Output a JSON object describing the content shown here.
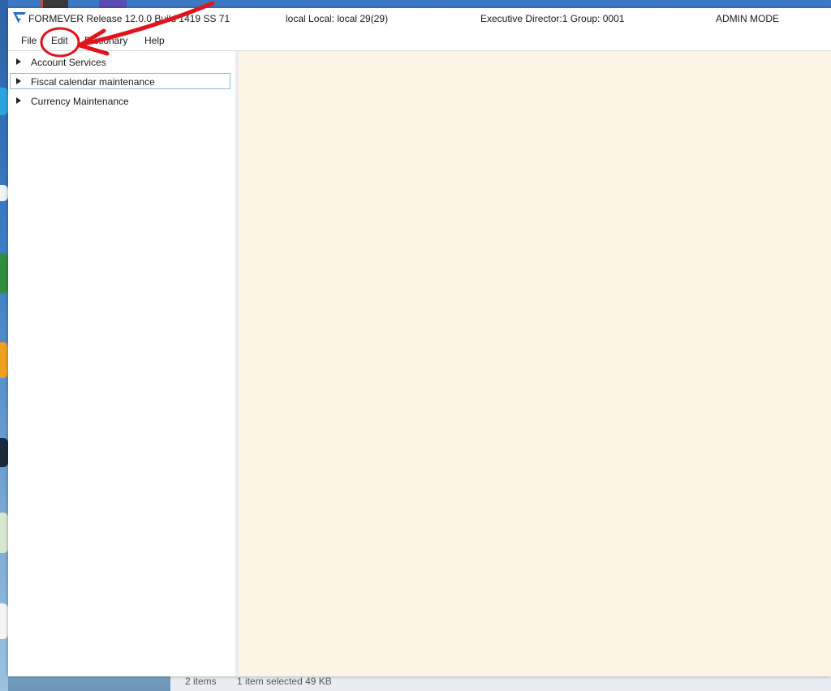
{
  "window": {
    "title_app": "FORMEVER Release 12.0.0 Build 1419 SS 71",
    "title_local": "local Local: local 29(29)",
    "title_role": "Executive Director:1 Group: 0001",
    "title_mode": "ADMIN MODE"
  },
  "menu": {
    "items": [
      {
        "label": "File"
      },
      {
        "label": "Edit"
      },
      {
        "label": "Dictionary"
      },
      {
        "label": "Help"
      }
    ]
  },
  "tree": {
    "items": [
      {
        "label": "Account Services",
        "selected": false
      },
      {
        "label": "Fiscal calendar maintenance",
        "selected": true
      },
      {
        "label": "Currency Maintenance",
        "selected": false
      }
    ]
  },
  "background_window": {
    "status_items": "2 items",
    "status_selected": "1 item selected  49 KB"
  },
  "colors": {
    "content_bg": "#fcf5e6",
    "annotation": "#e0141a",
    "logo": "#2b6cc4"
  },
  "icons": {
    "logo": "formever-logo-icon",
    "tree_caret": "caret-right-icon"
  }
}
